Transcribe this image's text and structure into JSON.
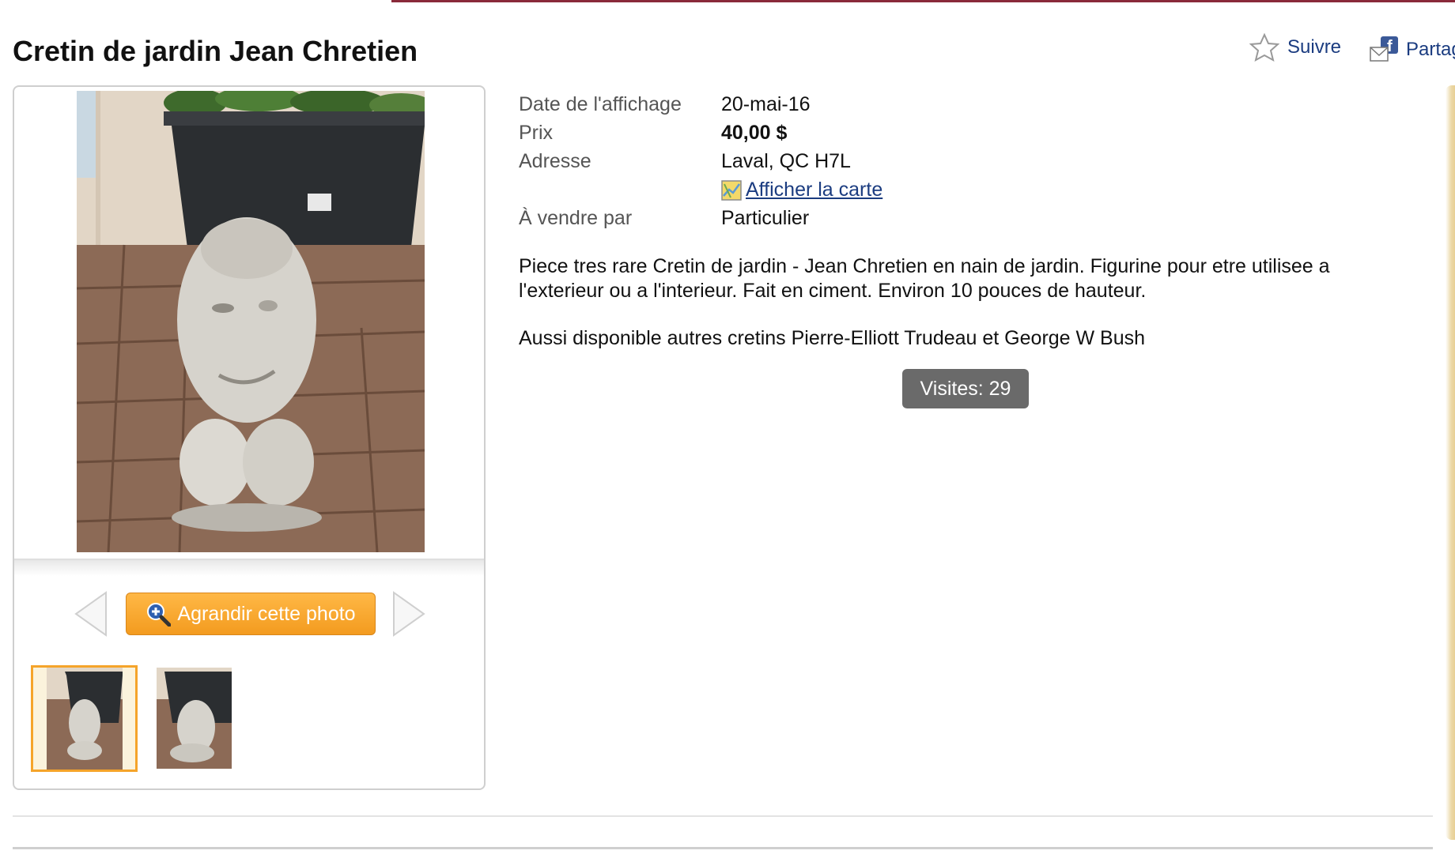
{
  "listing": {
    "title": "Cretin de jardin Jean Chretien",
    "follow_label": "Suivre",
    "share_label": "Partag"
  },
  "details": {
    "rows": [
      {
        "label": "Date de l'affichage",
        "value": "20-mai-16"
      },
      {
        "label": "Prix",
        "value": "40,00 $"
      },
      {
        "label": "Adresse",
        "value": "Laval, QC H7L"
      },
      {
        "label": "À vendre par",
        "value": "Particulier"
      }
    ],
    "map_link": "Afficher la carte"
  },
  "description": {
    "paragraph1": "Piece tres rare Cretin de jardin - Jean Chretien en nain de jardin. Figurine pour etre utilisee a l'exterieur ou a l'interieur. Fait en ciment. Environ 10 pouces de hauteur.",
    "paragraph2": "Aussi disponible autres cretins Pierre-Elliott Trudeau et George W Bush"
  },
  "visits": "Visites: 29",
  "gallery": {
    "enlarge_label": "Agrandir cette photo",
    "selected_thumbnail": 1
  },
  "icons": {
    "follow": "star-outline-icon",
    "share": "facebook-envelope-icon",
    "map": "map-icon",
    "enlarge": "magnifier-plus-icon",
    "prev": "arrow-left-icon",
    "next": "arrow-right-icon"
  },
  "colors": {
    "link": "#1b3c80",
    "button_orange": "#f5a42a",
    "visits_bg": "#6a6a6a",
    "top_rule": "#8a2a3a"
  }
}
